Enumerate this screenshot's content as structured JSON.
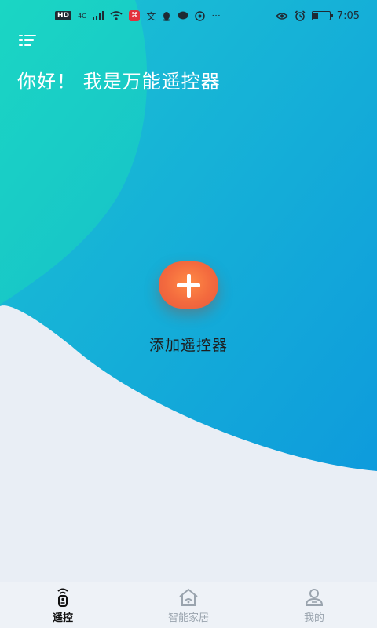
{
  "status_bar": {
    "hd_label": "HD",
    "network_label": "4G",
    "time": "7:05",
    "icons": [
      "signal-icon",
      "wifi-icon",
      "app-notification-icon",
      "translate-icon",
      "qq-icon",
      "message-icon",
      "nfc-icon",
      "more-icon",
      "eye-icon",
      "alarm-icon",
      "battery-icon"
    ],
    "battery_level": 0.3
  },
  "header": {
    "menu_icon": "menu-icon",
    "greeting": "你好！ 我是万能遥控器"
  },
  "main": {
    "add_icon": "plus-icon",
    "add_label": "添加遥控器"
  },
  "tabbar": {
    "tabs": [
      {
        "label": "遥控",
        "icon": "remote-icon",
        "active": true
      },
      {
        "label": "智能家居",
        "icon": "home-icon",
        "active": false
      },
      {
        "label": "我的",
        "icon": "user-icon",
        "active": false
      }
    ]
  },
  "colors": {
    "accent_teal": "#1ad0c2",
    "accent_blue": "#109fdd",
    "add_button": "#f36a3e",
    "background": "#e9eef5"
  }
}
